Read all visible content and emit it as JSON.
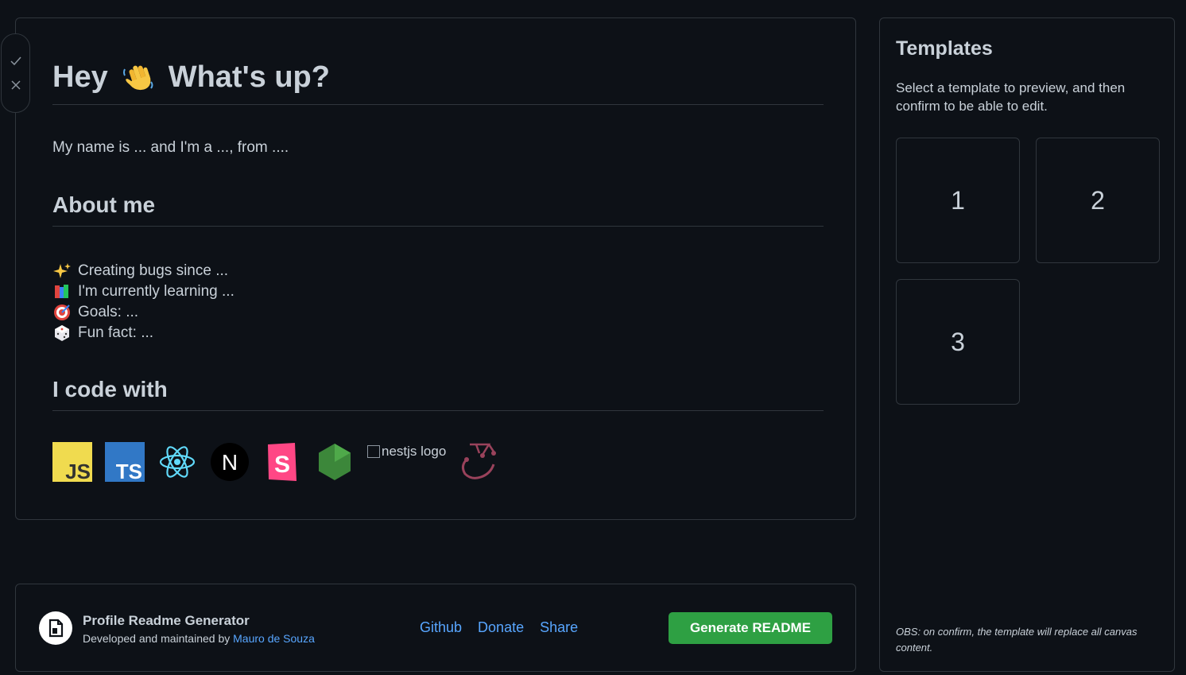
{
  "canvas": {
    "heading": "Hey",
    "heading_rest": "What's up?",
    "intro": "My name is ... and I'm a ..., from ....",
    "about_title": "About me",
    "about_items": [
      {
        "icon": "sparkles-icon",
        "text": "Creating bugs since ..."
      },
      {
        "icon": "books-icon",
        "text": "I'm currently learning ..."
      },
      {
        "icon": "target-icon",
        "text": "Goals: ..."
      },
      {
        "icon": "dice-icon",
        "text": "Fun fact: ..."
      }
    ],
    "code_title": "I code with",
    "tech_logos": [
      "javascript-logo",
      "typescript-logo",
      "react-logo",
      "nextjs-logo",
      "storybook-logo",
      "nodejs-logo",
      "nestjs-logo",
      "jest-logo"
    ],
    "js_label": "JS",
    "ts_label": "TS",
    "next_label": "N",
    "storybook_label": "S",
    "nestjs_alt": "nestjs logo"
  },
  "templates": {
    "title": "Templates",
    "description": "Select a template to preview, and then confirm to be able to edit.",
    "cards": [
      "1",
      "2",
      "3"
    ],
    "obs": "OBS: on confirm, the template will replace all canvas content."
  },
  "footer": {
    "app_name": "Profile Readme Generator",
    "credit_prefix": "Developed and maintained by",
    "author": "Mauro de Souza",
    "links": [
      "Github",
      "Donate",
      "Share"
    ],
    "generate_label": "Generate README"
  },
  "colors": {
    "background": "#0d1117",
    "border": "#30363d",
    "text": "#c9d1d9",
    "link": "#58a6ff",
    "primary_button": "#2ea043"
  }
}
